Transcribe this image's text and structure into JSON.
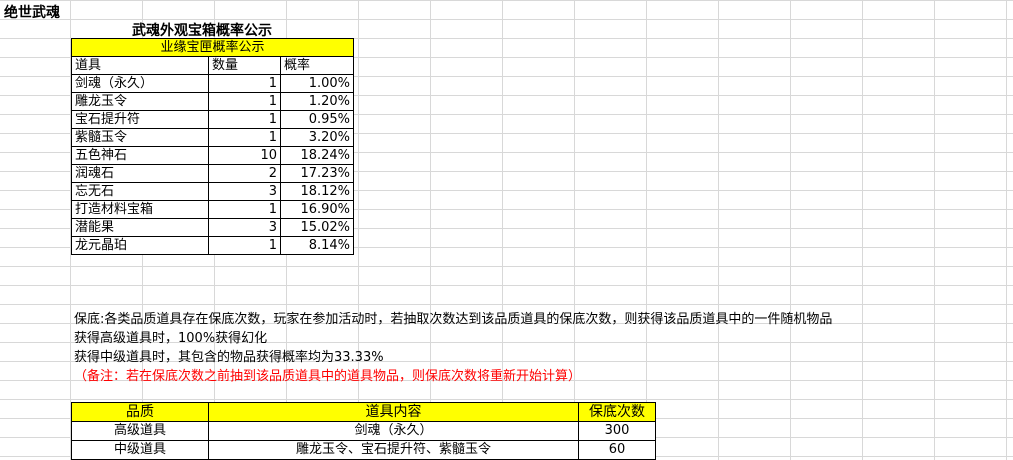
{
  "game_title": "绝世武魂",
  "sheet_title": "武魂外观宝箱概率公示",
  "prob_table": {
    "banner": "业缘宝匣概率公示",
    "headers": [
      "道具",
      "数量",
      "概率"
    ],
    "rows": [
      {
        "item": "剑魂（永久）",
        "qty": "1",
        "rate": "1.00%"
      },
      {
        "item": "雕龙玉令",
        "qty": "1",
        "rate": "1.20%"
      },
      {
        "item": "宝石提升符",
        "qty": "1",
        "rate": "0.95%"
      },
      {
        "item": "紫髓玉令",
        "qty": "1",
        "rate": "3.20%"
      },
      {
        "item": "五色神石",
        "qty": "10",
        "rate": "18.24%"
      },
      {
        "item": "润魂石",
        "qty": "2",
        "rate": "17.23%"
      },
      {
        "item": "忘无石",
        "qty": "3",
        "rate": "18.12%"
      },
      {
        "item": "打造材料宝箱",
        "qty": "1",
        "rate": "16.90%"
      },
      {
        "item": "潜能果",
        "qty": "3",
        "rate": "15.02%"
      },
      {
        "item": "龙元晶珀",
        "qty": "1",
        "rate": "8.14%"
      }
    ]
  },
  "notes": {
    "line1": "保底:各类品质道具存在保底次数，玩家在参加活动时，若抽取次数达到该品质道具的保底次数，则获得该品质道具中的一件随机物品",
    "line2": "获得高级道具时，100%获得幻化",
    "line3": "获得中级道具时，其包含的物品获得概率均为33.33%",
    "line4": "（备注：若在保底次数之前抽到该品质道具中的道具物品，则保底次数将重新开始计算）"
  },
  "guarantee_table": {
    "headers": [
      "品质",
      "道具内容",
      "保底次数"
    ],
    "rows": [
      {
        "quality": "高级道具",
        "content": "剑魂（永久）",
        "count": "300"
      },
      {
        "quality": "中级道具",
        "content": "雕龙玉令、宝石提升符、紫髓玉令",
        "count": "60"
      }
    ]
  },
  "colors": {
    "header_fill": "#ffff00",
    "note_red": "#ff0000",
    "gridline": "#d8d8d8"
  }
}
